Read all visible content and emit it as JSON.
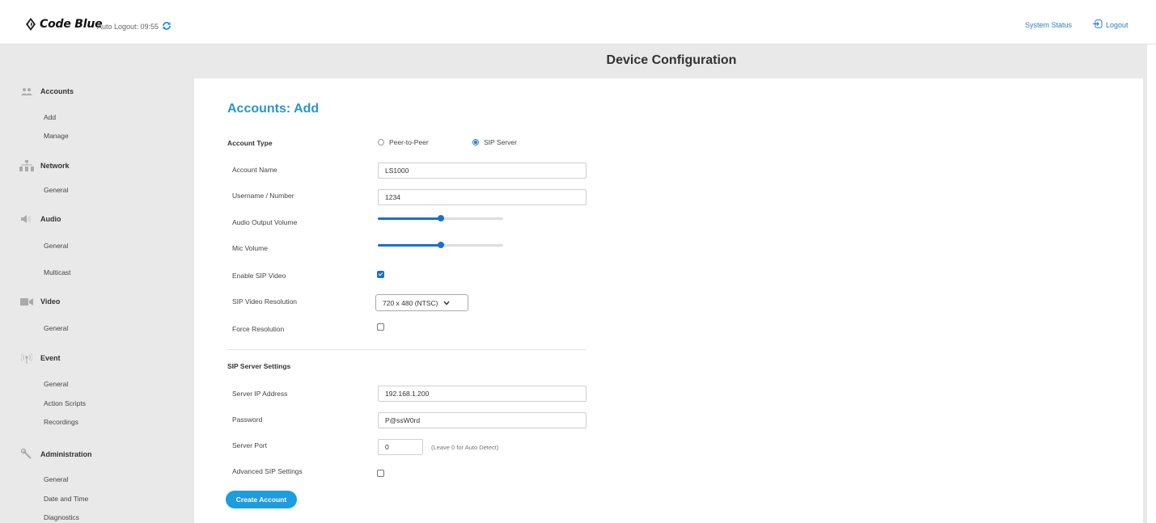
{
  "header": {
    "brand": "Code Blue",
    "auto_logout": "Auto Logout: 09:55",
    "system_status": "System Status",
    "logout": "Logout"
  },
  "page": {
    "title": "Device Configuration"
  },
  "sidebar": {
    "sections": [
      {
        "label": "Accounts",
        "icon": "users-icon",
        "items": [
          "Add",
          "Manage"
        ]
      },
      {
        "label": "Network",
        "icon": "network-icon",
        "items": [
          "General"
        ]
      },
      {
        "label": "Audio",
        "icon": "speaker-icon",
        "items": [
          "General",
          "Multicast"
        ]
      },
      {
        "label": "Video",
        "icon": "video-camera-icon",
        "items": [
          "General"
        ]
      },
      {
        "label": "Event",
        "icon": "broadcast-icon",
        "items": [
          "General",
          "Action Scripts",
          "Recordings"
        ]
      },
      {
        "label": "Administration",
        "icon": "wrench-icon",
        "items": [
          "General",
          "Date and Time",
          "Diagnostics"
        ]
      }
    ]
  },
  "form": {
    "heading": "Accounts: Add",
    "account_type": {
      "label": "Account Type",
      "options": [
        "Peer-to-Peer",
        "SIP Server"
      ],
      "selected": "SIP Server"
    },
    "account_name": {
      "label": "Account Name",
      "value": "LS1000"
    },
    "username": {
      "label": "Username / Number",
      "value": "1234"
    },
    "audio_output_volume": {
      "label": "Audio Output Volume",
      "level_percent": 50
    },
    "mic_volume": {
      "label": "Mic Volume",
      "level_percent": 50
    },
    "enable_sip_video": {
      "label": "Enable SIP Video",
      "checked": true
    },
    "sip_video_resolution": {
      "label": "SIP Video Resolution",
      "value": "720 x 480 (NTSC)"
    },
    "force_resolution": {
      "label": "Force Resolution",
      "checked": false
    },
    "sip_server_settings": {
      "heading": "SIP Server Settings",
      "server_ip": {
        "label": "Server IP Address",
        "value": "192.168.1.200"
      },
      "password": {
        "label": "Password",
        "value": "P@ssW0rd"
      },
      "server_port": {
        "label": "Server Port",
        "value": "0",
        "hint": "(Leave 0 for Auto Detect)"
      },
      "advanced": {
        "label": "Advanced SIP Settings",
        "checked": false
      }
    },
    "submit_label": "Create Account"
  }
}
